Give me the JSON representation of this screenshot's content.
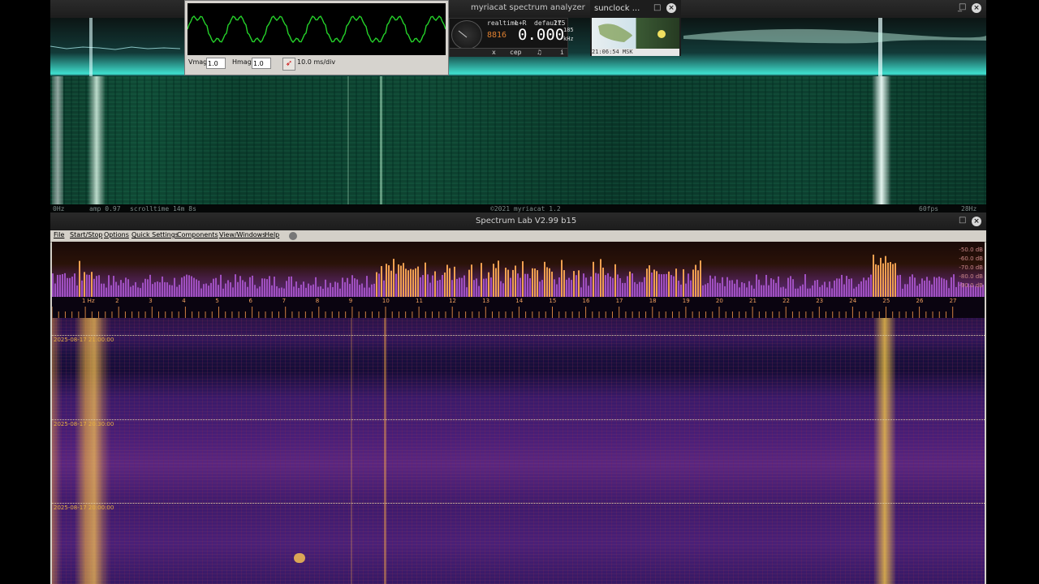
{
  "myriacat": {
    "title": "myriacat spectrum analyzer",
    "status_left": "0Hz",
    "status_amp": "amp 0.97",
    "status_scroll": "scrolltime 14m 8s",
    "status_copyright": "©2021 myriacat 1.2",
    "status_fps": "60fps",
    "status_freq_max": "28Hz",
    "accent": "#3fe0cf"
  },
  "scope": {
    "vmag_label": "Vmag",
    "vmag_value": "1.0",
    "hmag_label": "Hmag",
    "hmag_value": "1.0",
    "timebase": "10.0 ms/div",
    "trace_color": "#25d12a"
  },
  "meter": {
    "mode": "realtime",
    "channel": "L+R",
    "preset": "default",
    "value_top": "275",
    "digits_small": "8816",
    "main_value": "0.000",
    "unit_top": "185",
    "unit": "kHz",
    "btn1": "x",
    "btn2": "cep",
    "btn3": "♫",
    "btn4": "i"
  },
  "sunclock": {
    "title": "sunclock ...",
    "time": "21:06:54 MSK"
  },
  "spectrum_lab": {
    "title": "Spectrum Lab V2.99 b15",
    "menu": [
      "File",
      "Start/Stop",
      "Options",
      "Quick Settings",
      "Components",
      "View/Windows",
      "Help"
    ],
    "db_labels": [
      "-50.0 dB",
      "-60.0 dB",
      "-70.0 dB",
      "-80.0 dB",
      "-90.0 dB",
      "-90.0 dB"
    ],
    "freq_ticks": [
      "1 Hz",
      "2",
      "3",
      "4",
      "5",
      "6",
      "7",
      "8",
      "9",
      "10",
      "11",
      "12",
      "13",
      "14",
      "15",
      "16",
      "17",
      "18",
      "19",
      "20",
      "21",
      "22",
      "23",
      "24",
      "25",
      "26",
      "27"
    ],
    "timestamps": [
      "2025-08-17 21:00:00",
      "2025-08-17 20:30:00",
      "2025-08-17 20:00:00"
    ]
  }
}
